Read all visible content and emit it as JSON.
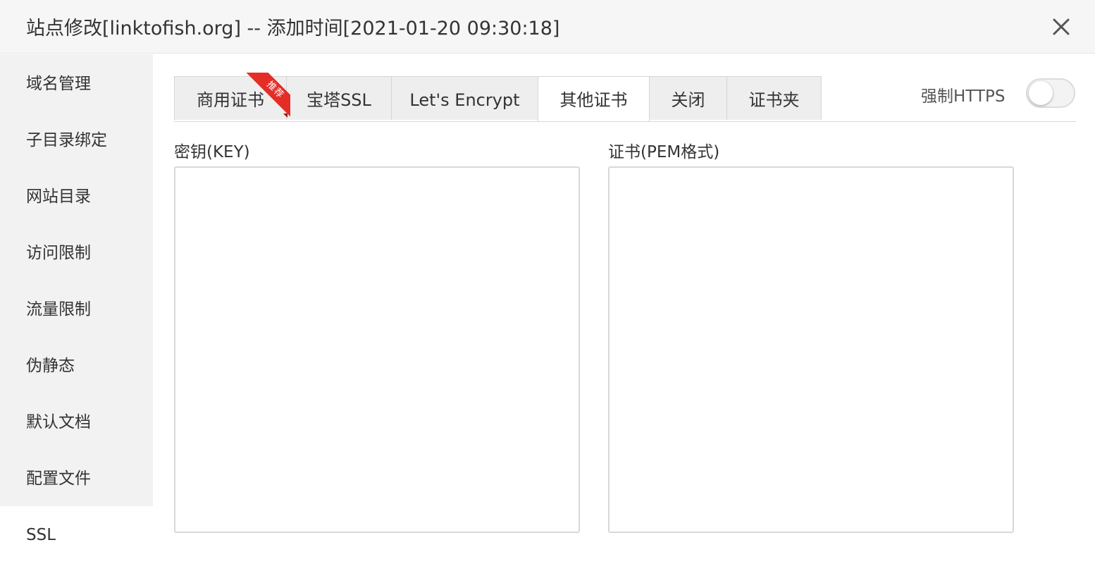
{
  "dialog": {
    "title": "站点修改[linktofish.org] -- 添加时间[2021-01-20 09:30:18]",
    "close_icon": "close-icon"
  },
  "sidebar": {
    "items": [
      {
        "label": "域名管理",
        "active": false
      },
      {
        "label": "子目录绑定",
        "active": false
      },
      {
        "label": "网站目录",
        "active": false
      },
      {
        "label": "访问限制",
        "active": false
      },
      {
        "label": "流量限制",
        "active": false
      },
      {
        "label": "伪静态",
        "active": false
      },
      {
        "label": "默认文档",
        "active": false
      },
      {
        "label": "配置文件",
        "active": false
      },
      {
        "label": "SSL",
        "active": true
      }
    ]
  },
  "ssl": {
    "tabs": [
      {
        "label": "商用证书",
        "active": false
      },
      {
        "label": "宝塔SSL",
        "active": false
      },
      {
        "label": "Let's Encrypt",
        "active": false
      },
      {
        "label": "其他证书",
        "active": true
      },
      {
        "label": "关闭",
        "active": false
      },
      {
        "label": "证书夹",
        "active": false
      }
    ],
    "ribbon_label": "推荐",
    "force_https": {
      "label": "强制HTTPS",
      "enabled": false
    },
    "key_label": "密钥(KEY)",
    "key_value": "",
    "cert_label": "证书(PEM格式)",
    "cert_value": ""
  },
  "colors": {
    "ribbon": "#e52d27",
    "sidebar_bg": "#f2f2f2",
    "titlebar_bg": "#f6f6f6",
    "tab_bg": "#eeeeee"
  }
}
